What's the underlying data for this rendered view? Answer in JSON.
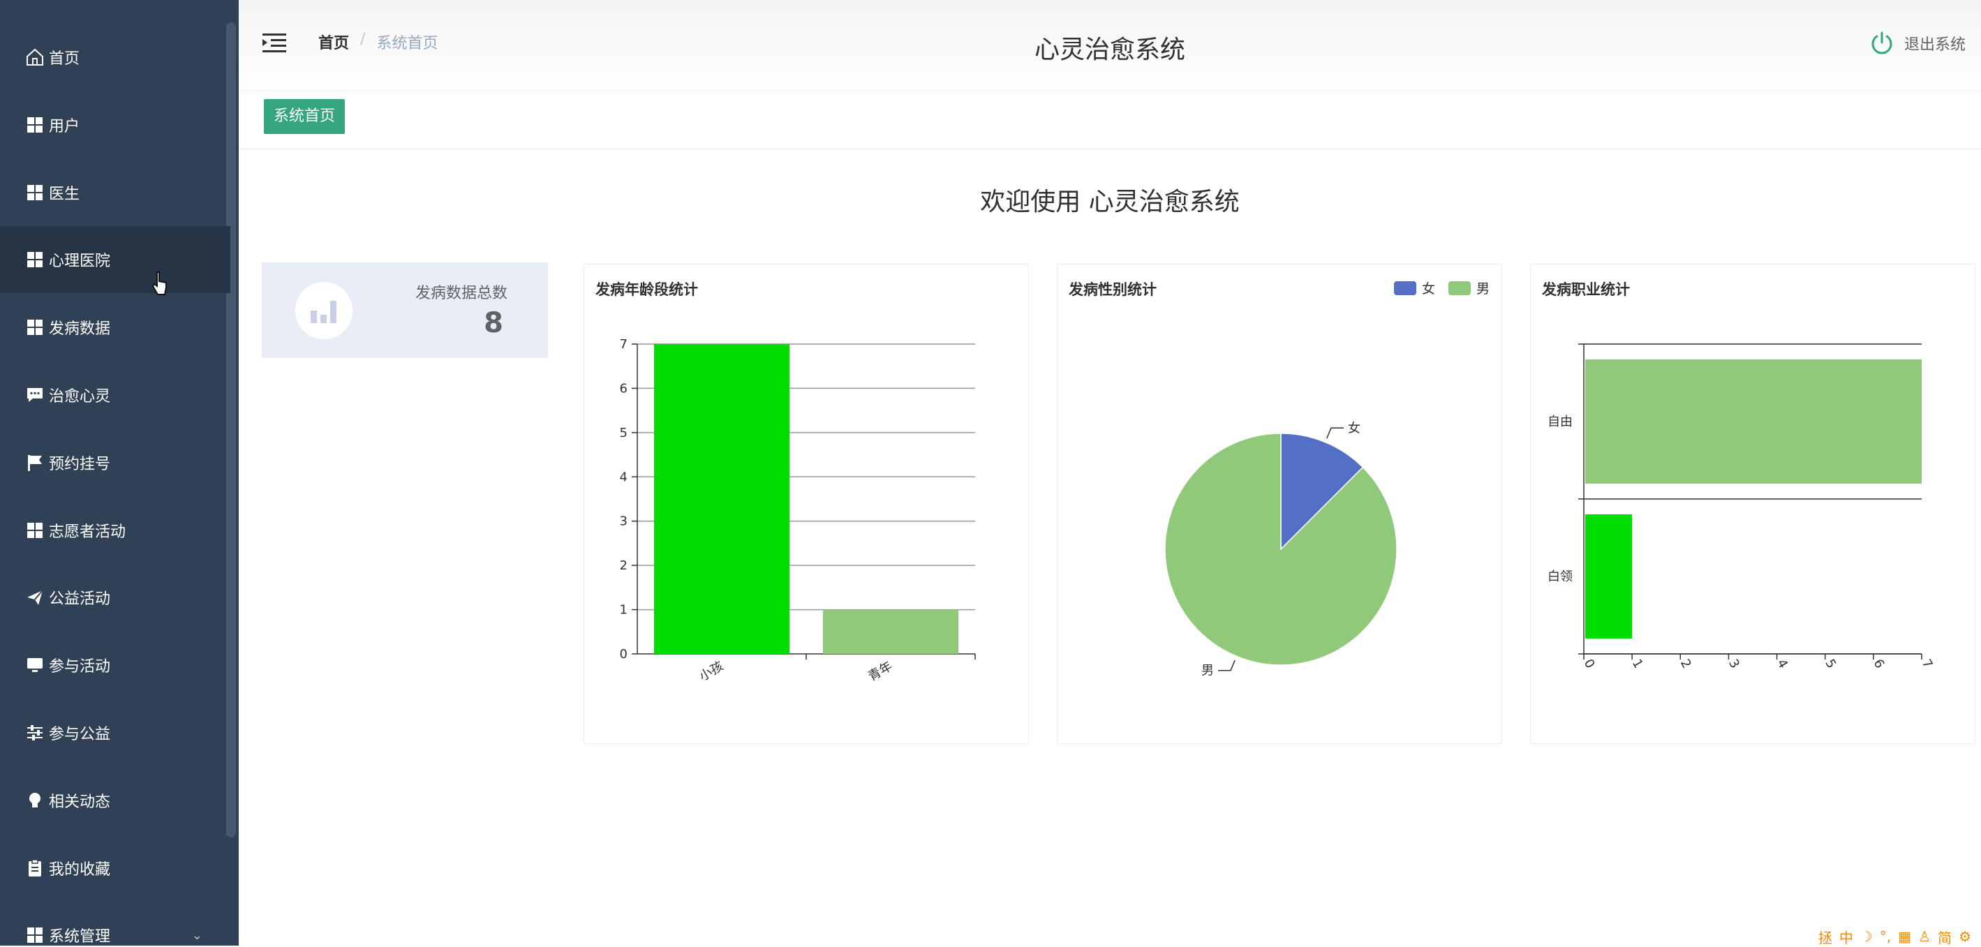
{
  "sidebar": {
    "items": [
      {
        "label": "首页",
        "icon": "home-icon"
      },
      {
        "label": "用户",
        "icon": "grid-icon"
      },
      {
        "label": "医生",
        "icon": "grid-icon"
      },
      {
        "label": "心理医院",
        "icon": "grid-icon"
      },
      {
        "label": "发病数据",
        "icon": "grid-icon"
      },
      {
        "label": "治愈心灵",
        "icon": "message-icon"
      },
      {
        "label": "预约挂号",
        "icon": "flag-icon"
      },
      {
        "label": "志愿者活动",
        "icon": "grid-icon"
      },
      {
        "label": "公益活动",
        "icon": "send-icon"
      },
      {
        "label": "参与活动",
        "icon": "monitor-icon"
      },
      {
        "label": "参与公益",
        "icon": "sliders-icon"
      },
      {
        "label": "相关动态",
        "icon": "bulb-icon"
      },
      {
        "label": "我的收藏",
        "icon": "clipboard-icon"
      },
      {
        "label": "系统管理",
        "icon": "grid-icon"
      }
    ]
  },
  "header": {
    "breadcrumb_home": "首页",
    "breadcrumb_current": "系统首页",
    "app_title": "心灵治愈系统",
    "logout_label": "退出系统"
  },
  "tags": {
    "active_tag": "系统首页"
  },
  "main": {
    "welcome": "欢迎使用 心灵治愈系统",
    "total_label": "发病数据总数",
    "total_value": "8"
  },
  "colors": {
    "sidebar_bg": "#304156",
    "accent_green": "#34a57f",
    "bar_bright_green": "#00dd00",
    "bar_light_green": "#91c97a",
    "pie_blue": "#5470c6"
  },
  "chart_data": [
    {
      "type": "bar",
      "title": "发病年龄段统计",
      "categories": [
        "小孩",
        "青年"
      ],
      "values": [
        7,
        1
      ],
      "colors": [
        "#00dd00",
        "#91c97a"
      ],
      "ylim": [
        0,
        7
      ],
      "yticks": [
        0,
        1,
        2,
        3,
        4,
        5,
        6,
        7
      ],
      "grid": true
    },
    {
      "type": "pie",
      "title": "发病性别统计",
      "slices": [
        {
          "name": "女",
          "value": 1,
          "color": "#5470c6"
        },
        {
          "name": "男",
          "value": 7,
          "color": "#91c97a"
        }
      ],
      "legend": [
        "女",
        "男"
      ],
      "legend_position": "top-right"
    },
    {
      "type": "bar",
      "orientation": "horizontal",
      "title": "发病职业统计",
      "categories": [
        "自由",
        "白领"
      ],
      "values": [
        7,
        1
      ],
      "colors": [
        "#91c97a",
        "#00dd00"
      ],
      "xlim": [
        0,
        7
      ],
      "xticks": [
        0,
        1,
        2,
        3,
        4,
        5,
        6,
        7
      ],
      "grid": true
    }
  ],
  "tray": [
    "拯",
    "中",
    "☽",
    "°,",
    "▦",
    "♙",
    "简",
    "⚙"
  ]
}
